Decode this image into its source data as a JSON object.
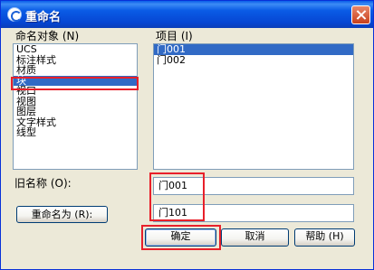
{
  "window": {
    "title": "重命名"
  },
  "left_panel": {
    "header": "命名对象 (N)",
    "items": [
      {
        "label": "UCS",
        "selected": false
      },
      {
        "label": "标注样式",
        "selected": false
      },
      {
        "label": "材质",
        "selected": false
      },
      {
        "label": "块",
        "selected": true
      },
      {
        "label": "视口",
        "selected": false
      },
      {
        "label": "视图",
        "selected": false
      },
      {
        "label": "图层",
        "selected": false
      },
      {
        "label": "文字样式",
        "selected": false
      },
      {
        "label": "线型",
        "selected": false
      }
    ]
  },
  "right_panel": {
    "header": "项目 (I)",
    "items": [
      {
        "label": "门001",
        "selected": true
      },
      {
        "label": "门002",
        "selected": false
      }
    ]
  },
  "old_name": {
    "label": "旧名称 (O):",
    "value": "门001"
  },
  "rename_to": {
    "button_label": "重命名为 (R):",
    "value": "门101"
  },
  "buttons": {
    "ok": "确定",
    "cancel": "取消",
    "help": "帮助 (H)"
  },
  "colors": {
    "title_bar": "#0a5ee9",
    "selection": "#316ac5",
    "highlight_annotation": "#e8202a"
  }
}
